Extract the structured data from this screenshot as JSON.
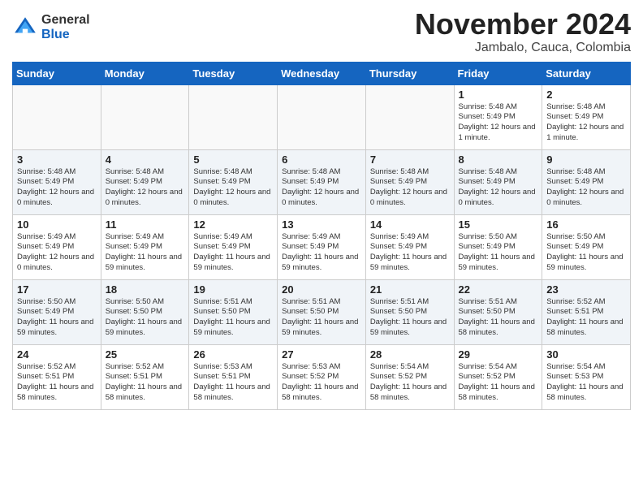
{
  "logo": {
    "general": "General",
    "blue": "Blue"
  },
  "title": "November 2024",
  "location": "Jambalo, Cauca, Colombia",
  "days_of_week": [
    "Sunday",
    "Monday",
    "Tuesday",
    "Wednesday",
    "Thursday",
    "Friday",
    "Saturday"
  ],
  "weeks": [
    {
      "row_class": "row-odd",
      "days": [
        {
          "date": "",
          "empty": true
        },
        {
          "date": "",
          "empty": true
        },
        {
          "date": "",
          "empty": true
        },
        {
          "date": "",
          "empty": true
        },
        {
          "date": "",
          "empty": true
        },
        {
          "date": "1",
          "sunrise": "Sunrise: 5:48 AM",
          "sunset": "Sunset: 5:49 PM",
          "daylight": "Daylight: 12 hours and 1 minute."
        },
        {
          "date": "2",
          "sunrise": "Sunrise: 5:48 AM",
          "sunset": "Sunset: 5:49 PM",
          "daylight": "Daylight: 12 hours and 1 minute."
        }
      ]
    },
    {
      "row_class": "row-even",
      "days": [
        {
          "date": "3",
          "sunrise": "Sunrise: 5:48 AM",
          "sunset": "Sunset: 5:49 PM",
          "daylight": "Daylight: 12 hours and 0 minutes."
        },
        {
          "date": "4",
          "sunrise": "Sunrise: 5:48 AM",
          "sunset": "Sunset: 5:49 PM",
          "daylight": "Daylight: 12 hours and 0 minutes."
        },
        {
          "date": "5",
          "sunrise": "Sunrise: 5:48 AM",
          "sunset": "Sunset: 5:49 PM",
          "daylight": "Daylight: 12 hours and 0 minutes."
        },
        {
          "date": "6",
          "sunrise": "Sunrise: 5:48 AM",
          "sunset": "Sunset: 5:49 PM",
          "daylight": "Daylight: 12 hours and 0 minutes."
        },
        {
          "date": "7",
          "sunrise": "Sunrise: 5:48 AM",
          "sunset": "Sunset: 5:49 PM",
          "daylight": "Daylight: 12 hours and 0 minutes."
        },
        {
          "date": "8",
          "sunrise": "Sunrise: 5:48 AM",
          "sunset": "Sunset: 5:49 PM",
          "daylight": "Daylight: 12 hours and 0 minutes."
        },
        {
          "date": "9",
          "sunrise": "Sunrise: 5:48 AM",
          "sunset": "Sunset: 5:49 PM",
          "daylight": "Daylight: 12 hours and 0 minutes."
        }
      ]
    },
    {
      "row_class": "row-odd",
      "days": [
        {
          "date": "10",
          "sunrise": "Sunrise: 5:49 AM",
          "sunset": "Sunset: 5:49 PM",
          "daylight": "Daylight: 12 hours and 0 minutes."
        },
        {
          "date": "11",
          "sunrise": "Sunrise: 5:49 AM",
          "sunset": "Sunset: 5:49 PM",
          "daylight": "Daylight: 11 hours and 59 minutes."
        },
        {
          "date": "12",
          "sunrise": "Sunrise: 5:49 AM",
          "sunset": "Sunset: 5:49 PM",
          "daylight": "Daylight: 11 hours and 59 minutes."
        },
        {
          "date": "13",
          "sunrise": "Sunrise: 5:49 AM",
          "sunset": "Sunset: 5:49 PM",
          "daylight": "Daylight: 11 hours and 59 minutes."
        },
        {
          "date": "14",
          "sunrise": "Sunrise: 5:49 AM",
          "sunset": "Sunset: 5:49 PM",
          "daylight": "Daylight: 11 hours and 59 minutes."
        },
        {
          "date": "15",
          "sunrise": "Sunrise: 5:50 AM",
          "sunset": "Sunset: 5:49 PM",
          "daylight": "Daylight: 11 hours and 59 minutes."
        },
        {
          "date": "16",
          "sunrise": "Sunrise: 5:50 AM",
          "sunset": "Sunset: 5:49 PM",
          "daylight": "Daylight: 11 hours and 59 minutes."
        }
      ]
    },
    {
      "row_class": "row-even",
      "days": [
        {
          "date": "17",
          "sunrise": "Sunrise: 5:50 AM",
          "sunset": "Sunset: 5:49 PM",
          "daylight": "Daylight: 11 hours and 59 minutes."
        },
        {
          "date": "18",
          "sunrise": "Sunrise: 5:50 AM",
          "sunset": "Sunset: 5:50 PM",
          "daylight": "Daylight: 11 hours and 59 minutes."
        },
        {
          "date": "19",
          "sunrise": "Sunrise: 5:51 AM",
          "sunset": "Sunset: 5:50 PM",
          "daylight": "Daylight: 11 hours and 59 minutes."
        },
        {
          "date": "20",
          "sunrise": "Sunrise: 5:51 AM",
          "sunset": "Sunset: 5:50 PM",
          "daylight": "Daylight: 11 hours and 59 minutes."
        },
        {
          "date": "21",
          "sunrise": "Sunrise: 5:51 AM",
          "sunset": "Sunset: 5:50 PM",
          "daylight": "Daylight: 11 hours and 59 minutes."
        },
        {
          "date": "22",
          "sunrise": "Sunrise: 5:51 AM",
          "sunset": "Sunset: 5:50 PM",
          "daylight": "Daylight: 11 hours and 58 minutes."
        },
        {
          "date": "23",
          "sunrise": "Sunrise: 5:52 AM",
          "sunset": "Sunset: 5:51 PM",
          "daylight": "Daylight: 11 hours and 58 minutes."
        }
      ]
    },
    {
      "row_class": "row-odd",
      "days": [
        {
          "date": "24",
          "sunrise": "Sunrise: 5:52 AM",
          "sunset": "Sunset: 5:51 PM",
          "daylight": "Daylight: 11 hours and 58 minutes."
        },
        {
          "date": "25",
          "sunrise": "Sunrise: 5:52 AM",
          "sunset": "Sunset: 5:51 PM",
          "daylight": "Daylight: 11 hours and 58 minutes."
        },
        {
          "date": "26",
          "sunrise": "Sunrise: 5:53 AM",
          "sunset": "Sunset: 5:51 PM",
          "daylight": "Daylight: 11 hours and 58 minutes."
        },
        {
          "date": "27",
          "sunrise": "Sunrise: 5:53 AM",
          "sunset": "Sunset: 5:52 PM",
          "daylight": "Daylight: 11 hours and 58 minutes."
        },
        {
          "date": "28",
          "sunrise": "Sunrise: 5:54 AM",
          "sunset": "Sunset: 5:52 PM",
          "daylight": "Daylight: 11 hours and 58 minutes."
        },
        {
          "date": "29",
          "sunrise": "Sunrise: 5:54 AM",
          "sunset": "Sunset: 5:52 PM",
          "daylight": "Daylight: 11 hours and 58 minutes."
        },
        {
          "date": "30",
          "sunrise": "Sunrise: 5:54 AM",
          "sunset": "Sunset: 5:53 PM",
          "daylight": "Daylight: 11 hours and 58 minutes."
        }
      ]
    }
  ]
}
